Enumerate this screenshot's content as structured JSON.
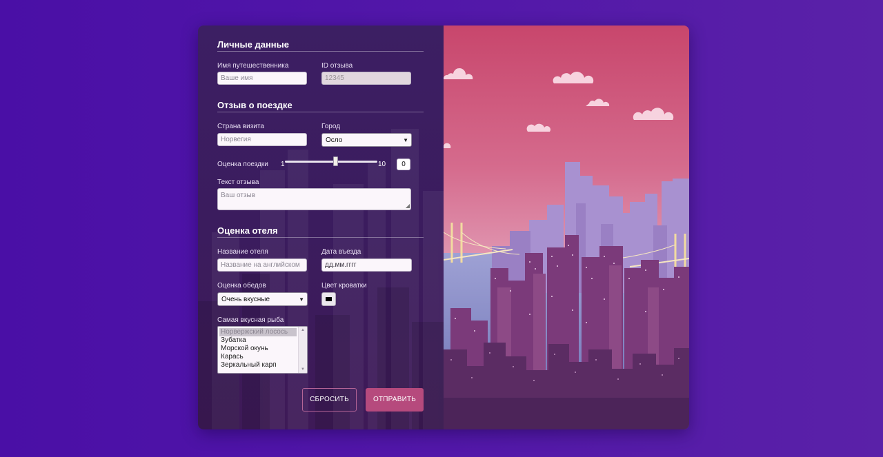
{
  "sections": {
    "personal": "Личные данные",
    "trip": "Отзыв о поездке",
    "hotel": "Оценка отеля"
  },
  "fields": {
    "traveler_name": {
      "label": "Имя путешественника",
      "placeholder": "Ваше имя"
    },
    "review_id": {
      "label": "ID отзыва",
      "placeholder": "12345"
    },
    "country": {
      "label": "Страна визита",
      "placeholder": "Норвегия"
    },
    "city": {
      "label": "Город",
      "value": "Осло"
    },
    "trip_rating": {
      "label": "Оценка поездки",
      "min": "1",
      "max": "10",
      "value": "0",
      "level": 0.55
    },
    "review_text": {
      "label": "Текст отзыва",
      "placeholder": "Ваш отзыв"
    },
    "hotel_name": {
      "label": "Название отеля",
      "placeholder": "Название на английском"
    },
    "checkin_date": {
      "label": "Дата въезда",
      "placeholder": "дд.мм.гггг"
    },
    "lunch_rating": {
      "label": "Оценка обедов",
      "value": "Очень вкусные"
    },
    "bed_color": {
      "label": "Цвет кроватки",
      "value": "#000000"
    },
    "best_fish": {
      "label": "Самая вкусная рыба",
      "options": [
        "Норвержский лосось",
        "Зубатка",
        "Морской окунь",
        "Карась",
        "Зеркальный карп"
      ],
      "selected_index": 0
    }
  },
  "buttons": {
    "reset": "СБРОСИТЬ",
    "submit": "ОТПРАВИТЬ"
  },
  "icons": {
    "select_arrow": "caret-down-icon",
    "resize": "resize-grip-icon"
  },
  "colors": {
    "background": "#4e15a8",
    "panel": "#3c1f63",
    "accent": "#b64a7d"
  }
}
